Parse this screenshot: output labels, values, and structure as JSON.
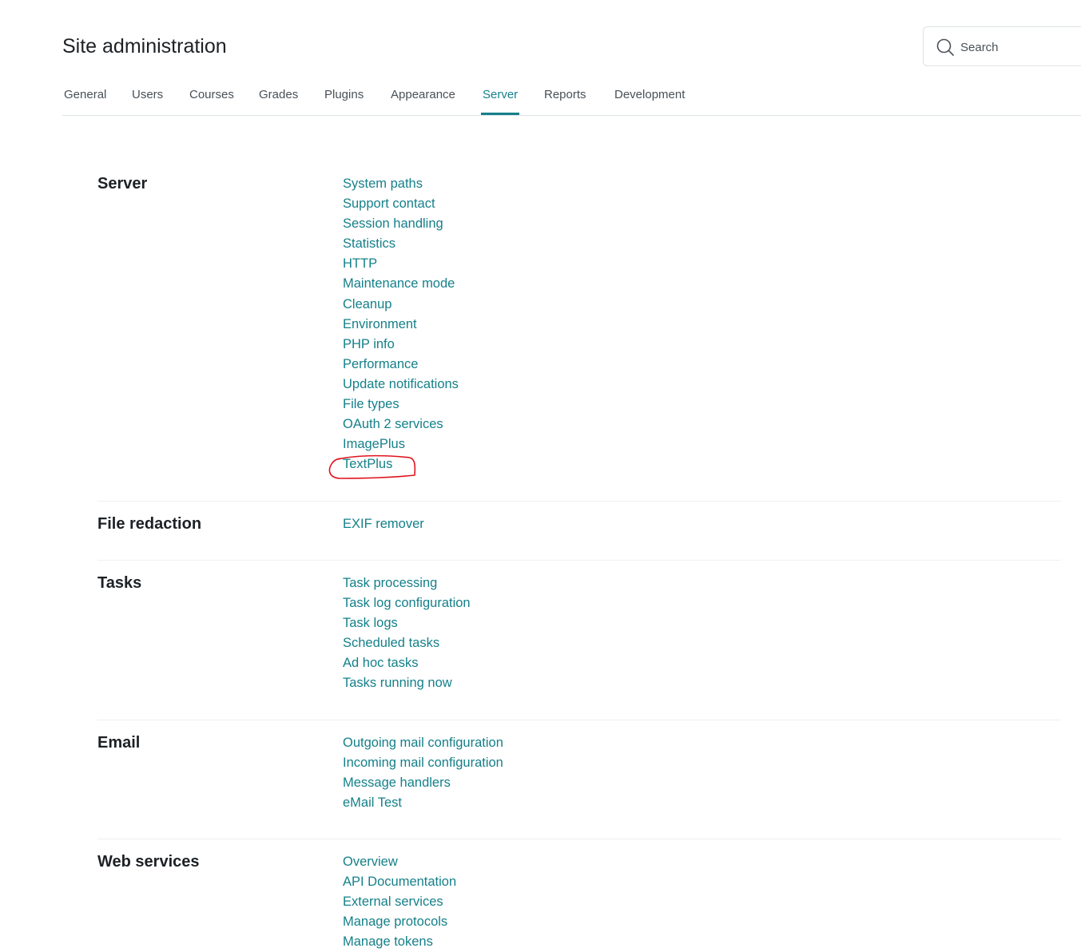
{
  "page": {
    "title": "Site administration"
  },
  "search": {
    "placeholder": "Search"
  },
  "tabs": [
    {
      "label": "General"
    },
    {
      "label": "Users"
    },
    {
      "label": "Courses"
    },
    {
      "label": "Grades"
    },
    {
      "label": "Plugins"
    },
    {
      "label": "Appearance"
    },
    {
      "label": "Server",
      "active": true
    },
    {
      "label": "Reports"
    },
    {
      "label": "Development"
    }
  ],
  "sections": [
    {
      "title": "Server",
      "links": [
        "System paths",
        "Support contact",
        "Session handling",
        "Statistics",
        "HTTP",
        "Maintenance mode",
        "Cleanup",
        "Environment",
        "PHP info",
        "Performance",
        "Update notifications",
        "File types",
        "OAuth 2 services",
        "ImagePlus",
        "TextPlus"
      ]
    },
    {
      "title": "File redaction",
      "links": [
        "EXIF remover"
      ]
    },
    {
      "title": "Tasks",
      "links": [
        "Task processing",
        "Task log configuration",
        "Task logs",
        "Scheduled tasks",
        "Ad hoc tasks",
        "Tasks running now"
      ]
    },
    {
      "title": "Email",
      "links": [
        "Outgoing mail configuration",
        "Incoming mail configuration",
        "Message handlers",
        "eMail Test"
      ]
    },
    {
      "title": "Web services",
      "links": [
        "Overview",
        "API Documentation",
        "External services",
        "Manage protocols",
        "Manage tokens"
      ]
    }
  ],
  "colors": {
    "link": "#15808a",
    "active_tab": "#15808a",
    "annotation": "#e0141e"
  },
  "annotation": {
    "circled_item": "TextPlus"
  }
}
